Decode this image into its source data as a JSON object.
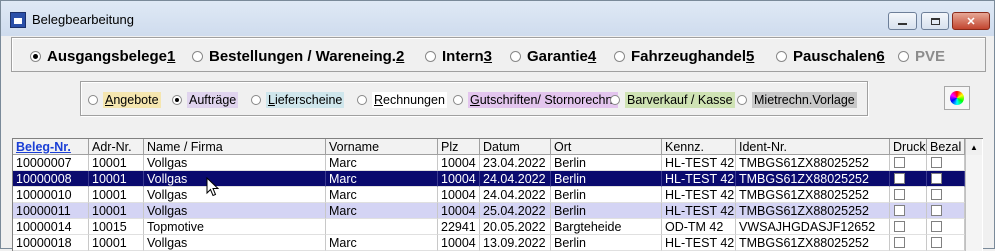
{
  "window": {
    "title": "Belegbearbeitung"
  },
  "doc_types": [
    {
      "label": "Ausgangsbelege ",
      "key": "1",
      "selected": true,
      "enabled": true
    },
    {
      "label": "Bestellungen / Wareneing. ",
      "key": "2",
      "selected": false,
      "enabled": true
    },
    {
      "label": "Intern ",
      "key": "3",
      "selected": false,
      "enabled": true
    },
    {
      "label": "Garantie ",
      "key": "4",
      "selected": false,
      "enabled": true
    },
    {
      "label": "Fahrzeughandel ",
      "key": "5",
      "selected": false,
      "enabled": true
    },
    {
      "label": "Pauschalen ",
      "key": "6",
      "selected": false,
      "enabled": true
    },
    {
      "label": "PVE",
      "key": "",
      "selected": false,
      "enabled": false
    }
  ],
  "sub_types": [
    {
      "label": "Angebote",
      "underline": "A",
      "rest": "ngebote",
      "color": "#f5e6b0",
      "selected": false
    },
    {
      "label": "Aufträge",
      "underline": "",
      "rest": "Aufträge",
      "color": "#e0d4ee",
      "selected": true
    },
    {
      "label": "Lieferscheine",
      "underline": "L",
      "rest": "ieferscheine",
      "color": "#cfe6ec",
      "selected": false
    },
    {
      "label": "Rechnungen",
      "underline": "R",
      "rest": "echnungen",
      "color": "#ffffff",
      "selected": false
    },
    {
      "label": "Gutschriften/ Stornorechn.",
      "underline": "G",
      "rest": "utschriften/ Stornorechn.",
      "color": "#e3c5ee",
      "selected": false
    },
    {
      "label": "Barverkauf / Kasse",
      "underline": "",
      "rest": "Barverkauf / Kasse",
      "color": "#cfe3b4",
      "selected": false
    },
    {
      "label": "Mietrechn.Vorlage",
      "underline": "",
      "rest": "Mietrechn.Vorlage",
      "color": "#c8c8c8",
      "selected": false
    }
  ],
  "table": {
    "columns": [
      "Beleg-Nr.",
      "Adr-Nr.",
      "Name / Firma",
      "Vorname",
      "Plz",
      "Datum",
      "Ort",
      "Kennz.",
      "Ident-Nr.",
      "Druck",
      "Bezal"
    ],
    "sorted_column": "Beleg-Nr.",
    "rows": [
      {
        "state": "normal",
        "cells": [
          "10000007",
          "10001",
          "Vollgas",
          "Marc",
          "10004",
          "23.04.2022",
          "Berlin",
          "HL-TEST 42",
          "TMBGS61ZX88025252",
          "",
          ""
        ]
      },
      {
        "state": "selected",
        "cells": [
          "10000008",
          "10001",
          "Vollgas",
          "Marc",
          "10004",
          "24.04.2022",
          "Berlin",
          "HL-TEST 42",
          "TMBGS61ZX88025252",
          "",
          ""
        ]
      },
      {
        "state": "normal",
        "cells": [
          "10000010",
          "10001",
          "Vollgas",
          "Marc",
          "10004",
          "24.04.2022",
          "Berlin",
          "HL-TEST 42",
          "TMBGS61ZX88025252",
          "",
          ""
        ]
      },
      {
        "state": "alt",
        "cells": [
          "10000011",
          "10001",
          "Vollgas",
          "Marc",
          "10004",
          "25.04.2022",
          "Berlin",
          "HL-TEST 42",
          "TMBGS61ZX88025252",
          "",
          ""
        ]
      },
      {
        "state": "normal",
        "cells": [
          "10000014",
          "10015",
          "Topmotive",
          "",
          "22941",
          "20.05.2022",
          "Bargteheide",
          "OD-TM 42",
          "VWSAJHGDASJF12652",
          "",
          ""
        ]
      },
      {
        "state": "normal",
        "cells": [
          "10000018",
          "10001",
          "Vollgas",
          "Marc",
          "10004",
          "13.09.2022",
          "Berlin",
          "HL-TEST 42",
          "TMBGS61ZX88025252",
          "",
          ""
        ]
      }
    ]
  }
}
